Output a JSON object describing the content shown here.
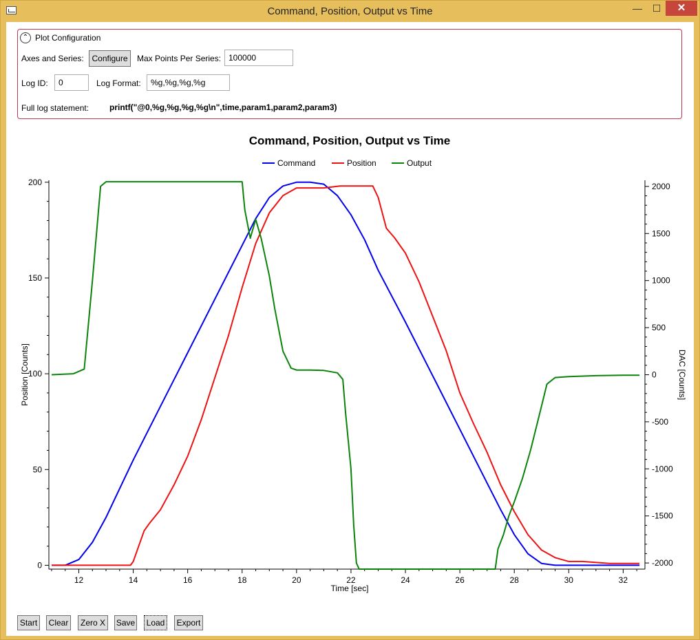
{
  "window": {
    "title": "Command, Position, Output vs Time",
    "minimize_glyph": "—",
    "maximize_glyph": "☐",
    "close_glyph": "✕",
    "app_icon": "plot-window-icon"
  },
  "config": {
    "header": "Plot Configuration",
    "collapse_glyph": "⌃",
    "axes_label": "Axes and Series:",
    "configure_button": "Configure",
    "max_points_label": "Max Points Per Series:",
    "max_points_value": "100000",
    "log_id_label": "Log ID:",
    "log_id_value": "0",
    "log_format_label": "Log Format:",
    "log_format_value": "%g,%g,%g,%g",
    "full_log_label": "Full log statement:",
    "full_log_value": "printf(\"@0,%g,%g,%g,%g\\n\",time,param1,param2,param3)"
  },
  "chart_data": {
    "type": "line",
    "title": "Command, Position, Output vs Time",
    "xlabel": "Time [sec]",
    "ylabel": "Position [Counts]",
    "y2label": "DAC [Counts]",
    "xlim": [
      10.9,
      32.8
    ],
    "ylim": [
      -2,
      201
    ],
    "y2lim": [
      -2065,
      2065
    ],
    "xticks": [
      12,
      14,
      16,
      18,
      20,
      22,
      24,
      26,
      28,
      30,
      32
    ],
    "yticks": [
      0,
      50,
      100,
      150,
      200
    ],
    "y2ticks": [
      2000,
      1500,
      1000,
      500,
      0,
      -500,
      -1000,
      -1500,
      -2000
    ],
    "legend_position": "top-center",
    "series": [
      {
        "name": "Command",
        "color": "#0000ee",
        "axis": "left",
        "x": [
          11.0,
          11.5,
          12.0,
          12.5,
          13.0,
          13.5,
          14.0,
          15.0,
          16.0,
          17.0,
          18.0,
          18.5,
          19.0,
          19.5,
          20.0,
          20.5,
          21.0,
          21.5,
          22.0,
          22.5,
          23.0,
          24.0,
          25.0,
          26.0,
          27.0,
          27.5,
          28.0,
          28.5,
          29.0,
          29.5,
          30.0,
          31.0,
          32.0,
          32.6
        ],
        "y": [
          0,
          0,
          3,
          12,
          25,
          40,
          55,
          83,
          111,
          139,
          167,
          181,
          192,
          198,
          200,
          200,
          199,
          193,
          183,
          170,
          154,
          127,
          99,
          71,
          43,
          29,
          16,
          6,
          1,
          0,
          0,
          0,
          0,
          0
        ]
      },
      {
        "name": "Position",
        "color": "#ee1111",
        "axis": "left",
        "x": [
          11.0,
          13.9,
          14.0,
          14.2,
          14.4,
          14.6,
          15.0,
          15.5,
          16.0,
          16.5,
          17.0,
          17.5,
          18.0,
          18.5,
          19.0,
          19.5,
          20.0,
          21.0,
          21.6,
          22.0,
          22.8,
          23.0,
          23.3,
          23.6,
          24.0,
          24.5,
          25.0,
          25.5,
          26.0,
          26.5,
          27.0,
          27.5,
          28.0,
          28.5,
          29.0,
          29.5,
          30.0,
          30.5,
          31.5,
          32.0,
          32.6
        ],
        "y": [
          0,
          0,
          2,
          10,
          18,
          22,
          29,
          42,
          57,
          76,
          98,
          120,
          145,
          168,
          184,
          193,
          197,
          197,
          198,
          198,
          198,
          192,
          176,
          171,
          163,
          148,
          130,
          112,
          90,
          74,
          59,
          42,
          28,
          16,
          8,
          4,
          2,
          2,
          1,
          1,
          1
        ]
      },
      {
        "name": "Output",
        "color": "#0a830a",
        "axis": "right",
        "x": [
          11.0,
          11.8,
          12.2,
          12.5,
          12.8,
          13.0,
          14.0,
          15.0,
          16.0,
          17.0,
          18.0,
          18.1,
          18.3,
          18.5,
          18.7,
          19.0,
          19.2,
          19.5,
          19.8,
          20.0,
          20.5,
          21.0,
          21.5,
          21.7,
          21.8,
          22.0,
          22.1,
          22.2,
          22.3,
          23.0,
          24.0,
          25.0,
          26.0,
          27.0,
          27.3,
          27.4,
          27.6,
          27.8,
          28.0,
          28.3,
          28.6,
          28.9,
          29.2,
          29.5,
          30.0,
          31.0,
          32.0,
          32.6
        ],
        "y": [
          0,
          10,
          60,
          1000,
          2000,
          2050,
          2050,
          2050,
          2050,
          2050,
          2050,
          1750,
          1450,
          1650,
          1450,
          1050,
          700,
          250,
          70,
          50,
          50,
          45,
          20,
          -50,
          -400,
          -1000,
          -1600,
          -2000,
          -2065,
          -2065,
          -2065,
          -2065,
          -2065,
          -2065,
          -2065,
          -1850,
          -1700,
          -1500,
          -1350,
          -1100,
          -800,
          -450,
          -100,
          -30,
          -20,
          -10,
          -5,
          -5
        ]
      }
    ]
  },
  "bottom": {
    "start": "Start",
    "clear": "Clear",
    "zero_x": "Zero X",
    "save": "Save",
    "load": "Load",
    "export": "Export"
  }
}
